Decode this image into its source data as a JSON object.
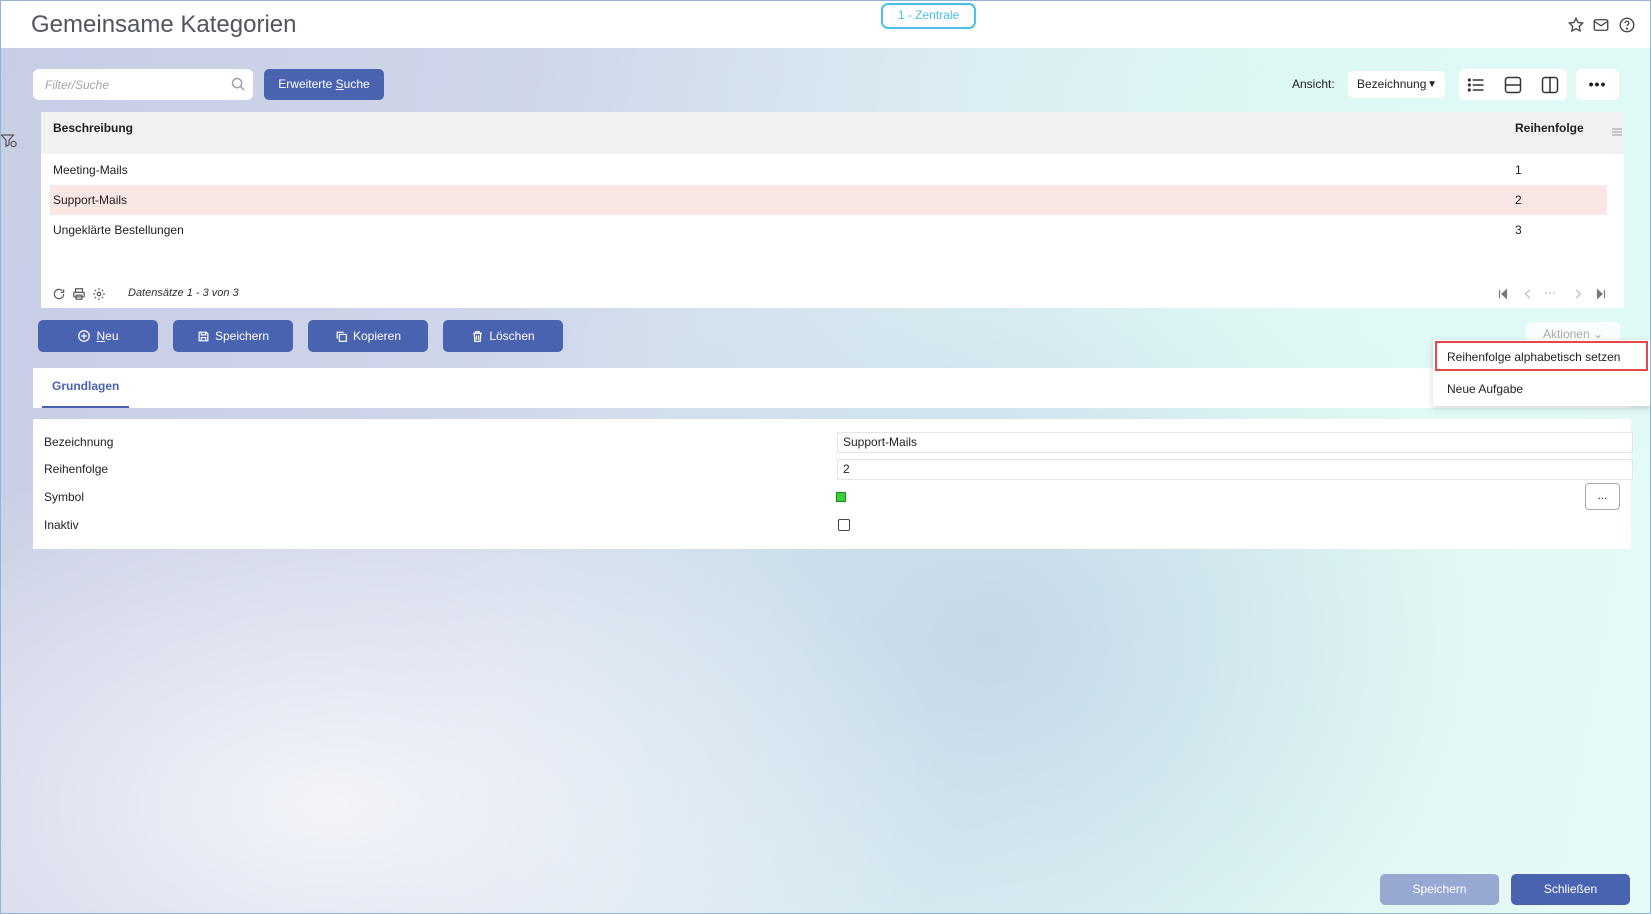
{
  "header": {
    "title": "Gemeinsame Kategorien",
    "company_badge": "1 - Zentrale",
    "icons": [
      "star-icon",
      "mail-icon",
      "help-icon"
    ]
  },
  "toolbar": {
    "search_placeholder": "Filter/Suche",
    "extended_search_label_prefix": "Erweiterte ",
    "extended_search_label_underlined": "S",
    "extended_search_label_suffix": "uche",
    "view_label": "Ansicht:",
    "view_selected": "Bezeichnung",
    "more_label": "•••"
  },
  "grid": {
    "columns": [
      "Beschreibung",
      "Reihenfolge"
    ],
    "rows": [
      {
        "beschreibung": "Meeting-Mails",
        "reihenfolge": "1",
        "selected": false
      },
      {
        "beschreibung": "Support-Mails",
        "reihenfolge": "2",
        "selected": true
      },
      {
        "beschreibung": "Ungeklärte Bestellungen",
        "reihenfolge": "3",
        "selected": false
      }
    ],
    "footer_text": "Datensätze 1 - 3 von 3",
    "pager_dots": "···"
  },
  "actions": {
    "new_label_underlined": "N",
    "new_label_rest": "eu",
    "save_label": "Speichern",
    "copy_label": "Kopieren",
    "delete_label": "Löschen",
    "more_actions_label": "Aktionen",
    "dropdown_items": [
      "Reihenfolge alphabetisch setzen",
      "Neue Aufgabe"
    ]
  },
  "tabs": {
    "active": "Grundlagen"
  },
  "form": {
    "fields": [
      {
        "label": "Bezeichnung",
        "value": "Support-Mails"
      },
      {
        "label": "Reihenfolge",
        "value": "2"
      },
      {
        "label": "Symbol",
        "value": ""
      },
      {
        "label": "Inaktiv",
        "value": ""
      }
    ],
    "symbol_color": "#3ccf3c",
    "symbol_button_label": "...",
    "inaktiv_checked": false
  },
  "footer": {
    "save_label": "Speichern",
    "close_label": "Schließen"
  },
  "colors": {
    "primary": "#4a63b0",
    "badge": "#4cbfe9",
    "selected_row": "#f8e7e5",
    "highlight": "#e04a4a",
    "disabled_primary": "#97a9d3"
  }
}
